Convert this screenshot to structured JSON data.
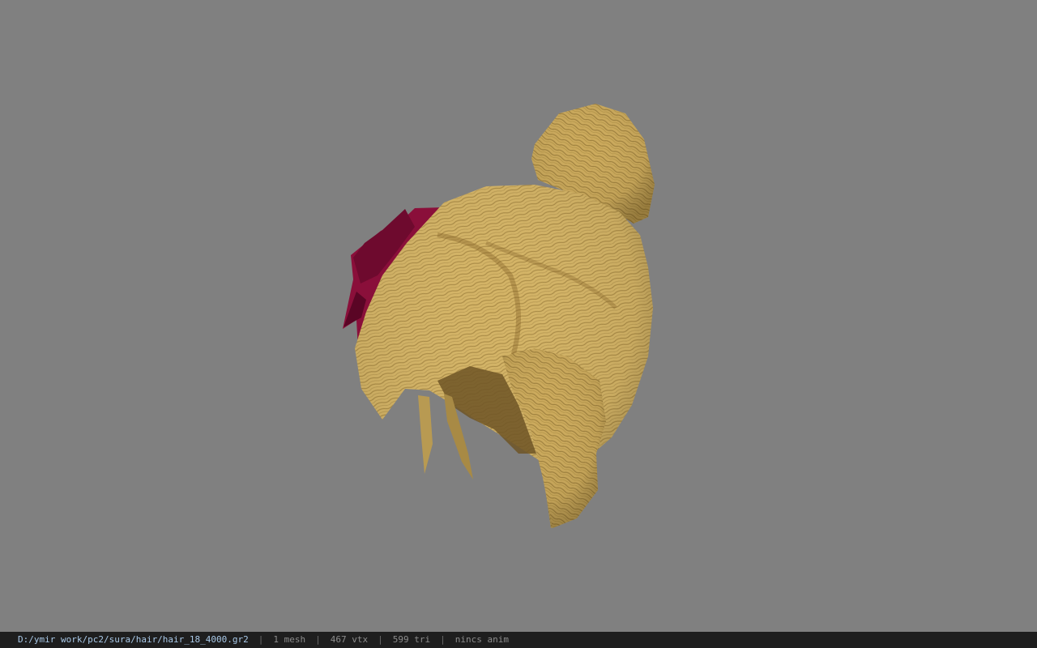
{
  "viewport": {
    "background_color": "#808080",
    "model": {
      "hair_color": "#d2b063",
      "hair_shadow_color": "#8a6a2a",
      "flower_color": "#8a0f3a",
      "flower_shadow_color": "#5a0525"
    }
  },
  "statusbar": {
    "file_path": "D:/ymir work/pc2/sura/hair/hair_18_4000.gr2",
    "separator": "|",
    "mesh_count": "1 mesh",
    "vertex_count": "467 vtx",
    "triangle_count": "599 tri",
    "anim_status": "nincs anim"
  }
}
